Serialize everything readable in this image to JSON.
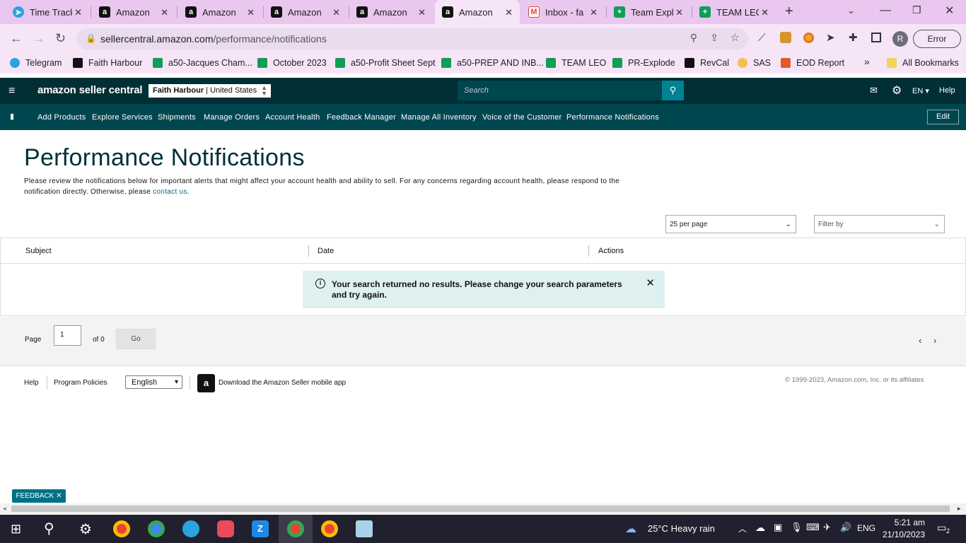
{
  "browser": {
    "tabs": [
      {
        "title": "Time Track",
        "icon": "telegram-icon",
        "color": "#2aa3df"
      },
      {
        "title": "Amazon",
        "icon": "amazon-icon",
        "color": "#111111"
      },
      {
        "title": "Amazon",
        "icon": "amazon-icon",
        "color": "#111111"
      },
      {
        "title": "Amazon",
        "icon": "amazon-icon",
        "color": "#111111"
      },
      {
        "title": "Amazon",
        "icon": "amazon-icon",
        "color": "#111111"
      },
      {
        "title": "Amazon",
        "icon": "amazon-icon",
        "color": "#111111"
      },
      {
        "title": "Inbox - fa",
        "icon": "gmail-icon",
        "color": "#ea4335"
      },
      {
        "title": "Team Expl",
        "icon": "sheets-icon",
        "color": "#0f9d58"
      },
      {
        "title": "TEAM LEO",
        "icon": "sheets-icon",
        "color": "#0f9d58"
      }
    ],
    "url_domain": "sellercentral.amazon.com",
    "url_path": "/performance/notifications",
    "profile_initial": "R",
    "error_label": "Error",
    "bookmarks": [
      {
        "label": "Telegram"
      },
      {
        "label": "Faith Harbour"
      },
      {
        "label": "a50-Jacques Cham..."
      },
      {
        "label": "October 2023"
      },
      {
        "label": "a50-Profit Sheet Sept"
      },
      {
        "label": "a50-PREP AND INB..."
      },
      {
        "label": "TEAM LEO"
      },
      {
        "label": "PR-Explode"
      },
      {
        "label": "RevCal"
      },
      {
        "label": "SAS"
      },
      {
        "label": "EOD Report"
      }
    ],
    "all_bookmarks": "All Bookmarks",
    "more": "»"
  },
  "seller": {
    "logo": "amazon seller central",
    "account_name": "Faith Harbour",
    "account_region": "United States",
    "search_placeholder": "Search",
    "lang": "EN",
    "help": "Help"
  },
  "nav": {
    "items": [
      "Add Products",
      "Explore Services",
      "Shipments",
      "Manage Orders",
      "Account Health",
      "Feedback Manager",
      "Manage All Inventory",
      "Voice of the Customer",
      "Performance Notifications"
    ],
    "edit": "Edit"
  },
  "page": {
    "title": "Performance Notifications",
    "desc1": "Please review the notifications below for important alerts that might affect your account health and ability to sell. For any concerns regarding account health, please respond to the notification directly. Otherwise, please ",
    "contact_link": "contact us",
    "desc_end": ".",
    "per_page": "25 per page",
    "filter": "Filter by"
  },
  "table": {
    "headers": [
      "Subject",
      "Date",
      "Actions"
    ],
    "alert": "Your search returned no results. Please change your search parameters and try again."
  },
  "pager": {
    "page_label": "Page",
    "page_value": "1",
    "of_label": "of 0",
    "go": "Go"
  },
  "footer": {
    "help": "Help",
    "policies": "Program Policies",
    "language": "English",
    "app": "Download the Amazon Seller mobile app",
    "copyright": "© 1999-2023, Amazon.com, Inc. or its affiliates"
  },
  "feedback": "FEEDBACK",
  "taskbar": {
    "weather": "25°C  Heavy rain",
    "lang": "ENG",
    "time": "5:21 am",
    "date": "21/10/2023",
    "notif_count": "2"
  }
}
